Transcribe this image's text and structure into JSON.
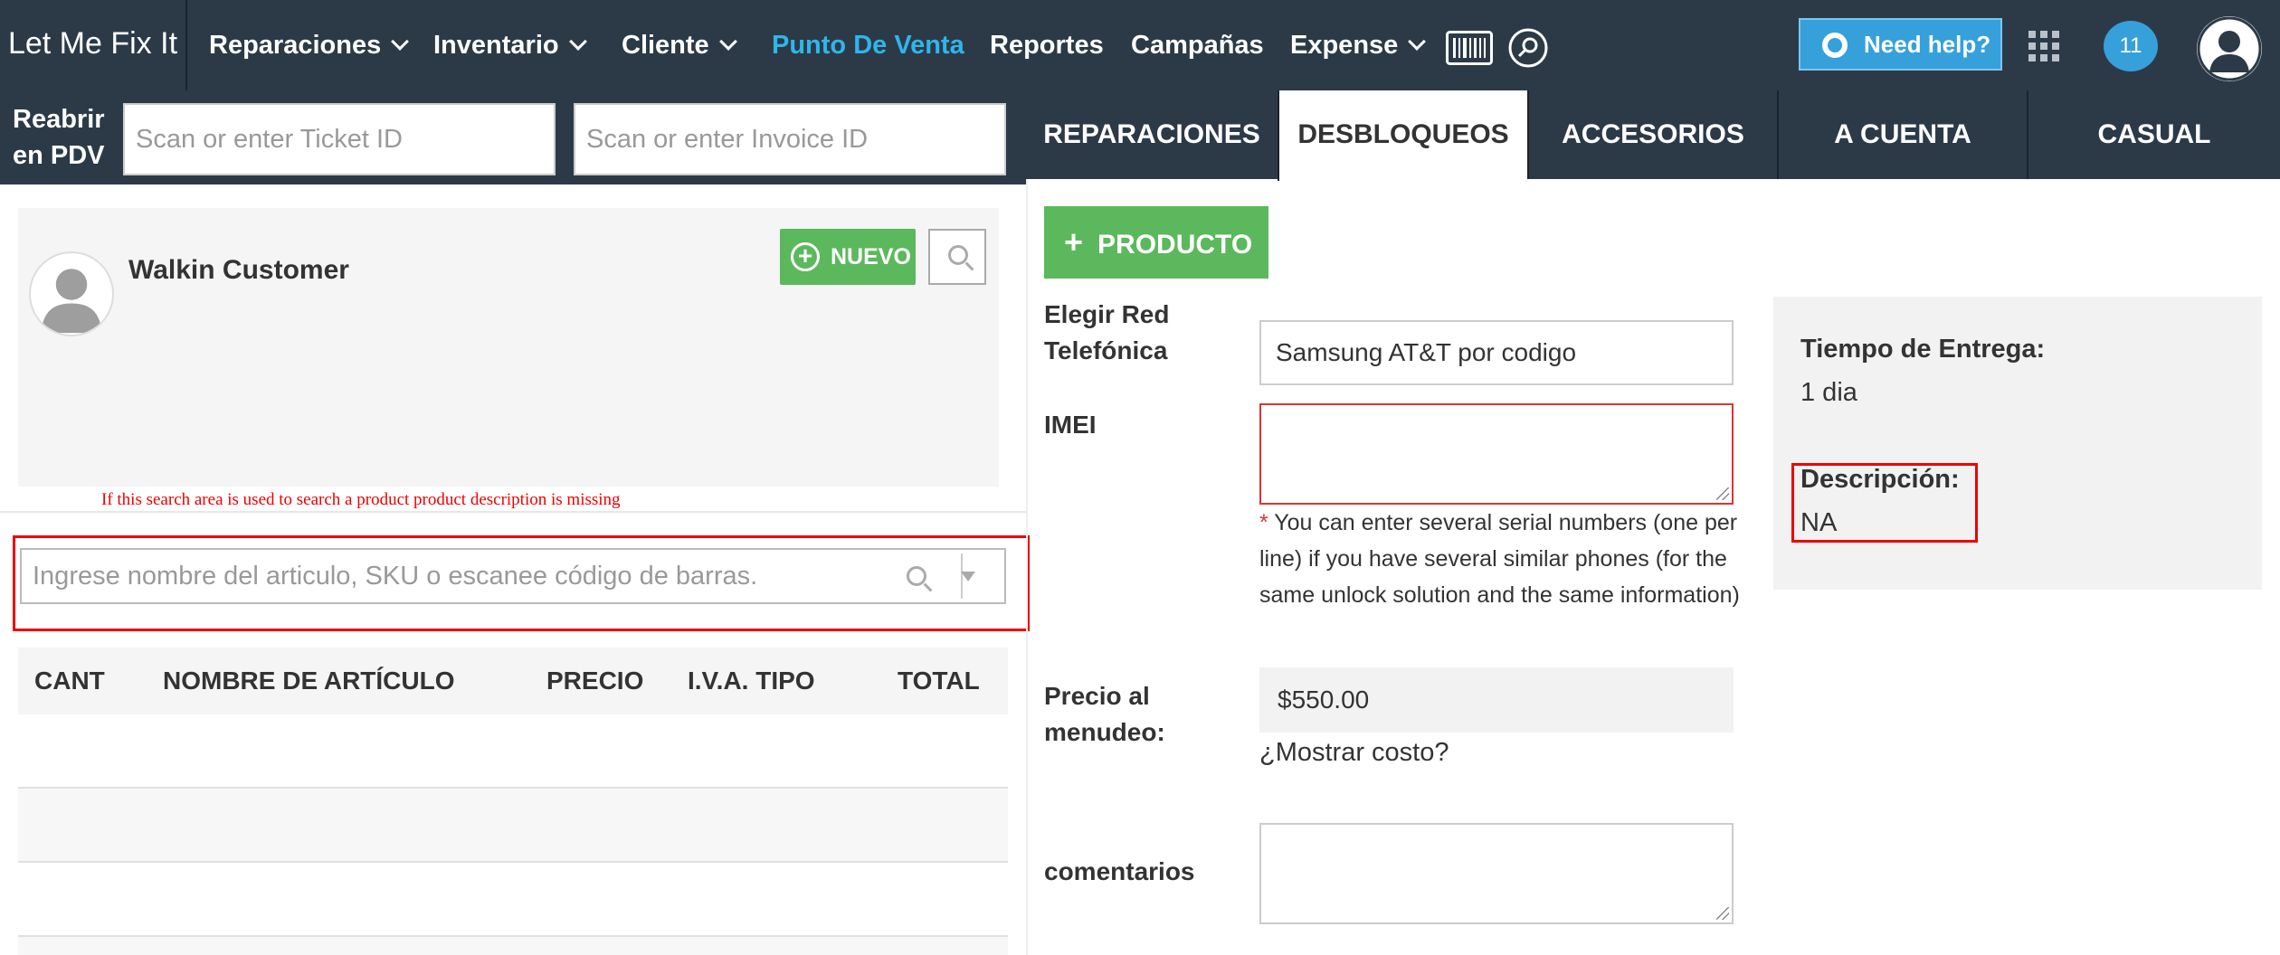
{
  "app": {
    "logo": "Let Me Fix It"
  },
  "nav": {
    "reparaciones": "Reparaciones",
    "inventario": "Inventario",
    "cliente": "Cliente",
    "punto_de_venta": "Punto De Venta",
    "reportes": "Reportes",
    "campanas": "Campañas",
    "expense": "Expense",
    "help": "Need help?",
    "notifications": "11"
  },
  "reopen": {
    "label_line1": "Reabrir",
    "label_line2": "en PDV",
    "ticket_placeholder": "Scan or enter Ticket ID",
    "invoice_placeholder": "Scan or enter Invoice ID"
  },
  "tabs": [
    "REPARACIONES",
    "DESBLOQUEOS",
    "ACCESORIOS",
    "A CUENTA",
    "CASUAL"
  ],
  "active_tab": "DESBLOQUEOS",
  "customer": {
    "name": "Walkin Customer",
    "new_label": "NUEVO"
  },
  "annotation": "If this search area is used to search a product product description is missing",
  "product_search": {
    "placeholder": "Ingrese nombre del articulo, SKU o escanee código de barras."
  },
  "table": {
    "headers": {
      "qty": "CANT",
      "name": "NOMBRE DE ARTÍCULO",
      "price": "PRECIO",
      "tax": "I.V.A. TIPO",
      "total": "TOTAL"
    }
  },
  "unlock_form": {
    "add_product": "PRODUCTO",
    "network_label_1": "Elegir Red",
    "network_label_2": "Telefónica",
    "network_value": "Samsung AT&T por codigo",
    "imei_label": "IMEI",
    "imei_help_star": "*",
    "imei_help": "You can enter several serial numbers (one per line) if you have several similar phones (for the same unlock solution and the same information)",
    "price_label_1": "Precio al",
    "price_label_2": "menudeo:",
    "price_value": "$550.00",
    "show_cost": "¿Mostrar costo?",
    "comments_label": "comentarios"
  },
  "info": {
    "delivery_label": "Tiempo de Entrega:",
    "delivery_value": "1 dia",
    "description_label": "Descripción:",
    "description_value": "NA"
  },
  "colors": {
    "topbar": "#2c3a48",
    "accent_blue": "#2fb6ea",
    "green": "#5cb85c",
    "annotation_red": "#e00000"
  }
}
